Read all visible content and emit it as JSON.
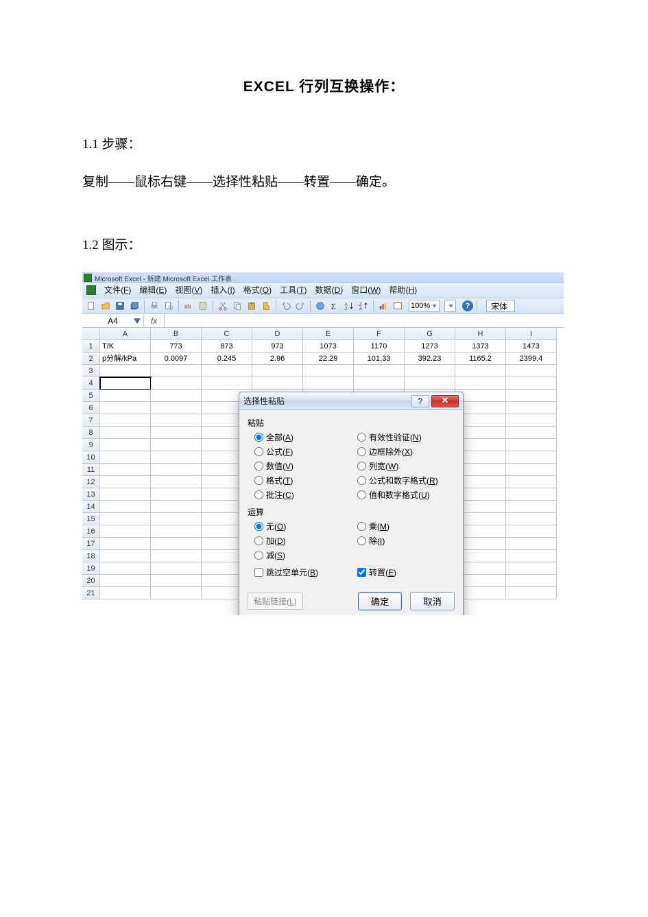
{
  "doc": {
    "title": "EXCEL 行列互换操作：",
    "section1_heading": "1.1 步骤：",
    "section1_body": "复制——鼠标右键——选择性粘贴——转置——确定。",
    "section2_heading": "1.2 图示："
  },
  "excel": {
    "app_title": "Microsoft Excel - 新建 Microsoft Excel 工作表",
    "menus": {
      "file": "文件",
      "file_k": "F",
      "edit": "编辑",
      "edit_k": "E",
      "view": "视图",
      "view_k": "V",
      "insert": "插入",
      "insert_k": "I",
      "format": "格式",
      "format_k": "O",
      "tools": "工具",
      "tools_k": "T",
      "data": "数据",
      "data_k": "D",
      "window": "窗口",
      "window_k": "W",
      "help": "帮助",
      "help_k": "H"
    },
    "zoom": "100%",
    "help_q": "?",
    "font_name": "宋体",
    "name_box": "A4",
    "fx_label": "fx",
    "columns": [
      "A",
      "B",
      "C",
      "D",
      "E",
      "F",
      "G",
      "H",
      "I"
    ],
    "rows_visible": 21
  },
  "chart_data": {
    "type": "table",
    "title": "",
    "columns": [
      "A",
      "B",
      "C",
      "D",
      "E",
      "F",
      "G",
      "H",
      "I"
    ],
    "rows": [
      [
        "T/K",
        "773",
        "873",
        "973",
        "1073",
        "1170",
        "1273",
        "1373",
        "1473"
      ],
      [
        "p分解/kPa",
        "0.0097",
        "0.245",
        "2.96",
        "22.29",
        "101.33",
        "392.23",
        "1165.2",
        "2399.4"
      ]
    ]
  },
  "dialog": {
    "title": "选择性粘贴",
    "help_symbol": "?",
    "close_symbol": "✕",
    "paste_group": "粘贴",
    "paste_options": {
      "all": {
        "label": "全部",
        "k": "A",
        "checked": true
      },
      "formulas": {
        "label": "公式",
        "k": "F",
        "checked": false
      },
      "values": {
        "label": "数值",
        "k": "V",
        "checked": false
      },
      "formats": {
        "label": "格式",
        "k": "T",
        "checked": false
      },
      "comments": {
        "label": "批注",
        "k": "C",
        "checked": false
      },
      "validation": {
        "label": "有效性验证",
        "k": "N",
        "checked": false
      },
      "noborder": {
        "label": "边框除外",
        "k": "X",
        "checked": false
      },
      "colwidth": {
        "label": "列宽",
        "k": "W",
        "checked": false
      },
      "fmt_num": {
        "label": "公式和数字格式",
        "k": "R",
        "checked": false
      },
      "val_num": {
        "label": "值和数字格式",
        "k": "U",
        "checked": false
      }
    },
    "op_group": "运算",
    "op_options": {
      "none": {
        "label": "无",
        "k": "O",
        "checked": true
      },
      "add": {
        "label": "加",
        "k": "D",
        "checked": false
      },
      "sub": {
        "label": "减",
        "k": "S",
        "checked": false
      },
      "mul": {
        "label": "乘",
        "k": "M",
        "checked": false
      },
      "div": {
        "label": "除",
        "k": "I",
        "checked": false
      }
    },
    "skip_blanks": {
      "label": "跳过空单元",
      "k": "B",
      "checked": false
    },
    "transpose": {
      "label": "转置",
      "k": "E",
      "checked": true
    },
    "paste_link": {
      "label": "粘贴链接",
      "k": "L"
    },
    "ok": "确定",
    "cancel": "取消"
  }
}
